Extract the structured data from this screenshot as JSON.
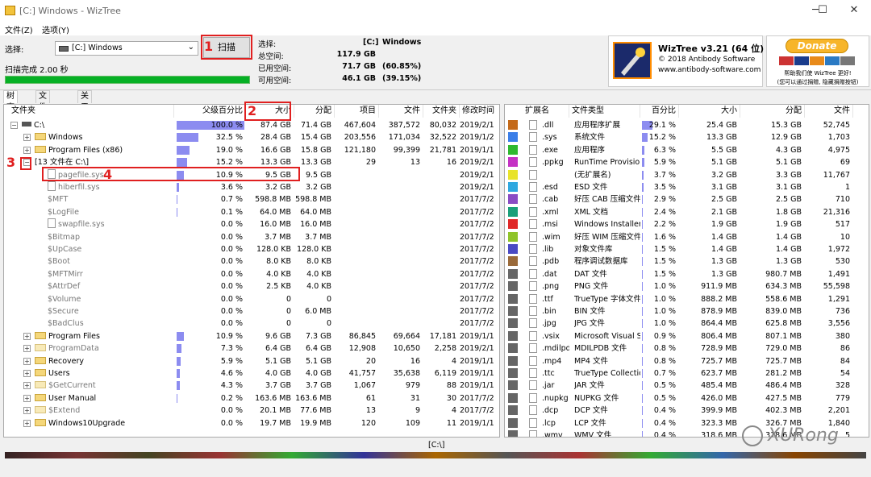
{
  "window": {
    "title": "[C:] Windows  -  WizTree",
    "min": "─",
    "max": "☐",
    "close": "✕"
  },
  "menu": [
    "文件(Z)",
    "选项(Y)"
  ],
  "toolbar": {
    "select_label": "选择:",
    "drive_value": "[C:] Windows",
    "scan_label": "扫描",
    "scan_done": "扫描完成 2.00 秒"
  },
  "info": {
    "select_label": "选择:",
    "select_drive": "[C:]",
    "select_name": "Windows",
    "total_label": "总空间:",
    "total_value": "117.9 GB",
    "used_label": "已用空间:",
    "used_value": "71.7 GB",
    "used_pct": "(60.85%)",
    "free_label": "可用空间:",
    "free_value": "46.1 GB",
    "free_pct": "(39.15%)",
    "progress": 1.0
  },
  "brand": {
    "name": "WizTree v3.21 (64 位)",
    "copyright": "© 2018 Antibody Software",
    "url": "www.antibody-software.com"
  },
  "donate": {
    "button": "Donate",
    "line1": "帮助我们使 WizTree 更好!",
    "line2": "(您可以通过捐赠, 隐藏捐赠按钮)"
  },
  "tabs": [
    "树查看",
    "文件查看",
    "关于"
  ],
  "tree": {
    "headers": [
      "文件夹",
      "父级百分比",
      "大小",
      "分配",
      "项目",
      "文件",
      "文件夹",
      "修改时间"
    ],
    "rows": [
      {
        "name": "C:\\",
        "pct": "100.0 %",
        "pctv": 100,
        "size": "87.4 GB",
        "alloc": "71.4 GB",
        "items": "467,604",
        "files": "387,572",
        "folders": "80,032",
        "mod": "2019/2/1",
        "indent": 0,
        "type": "drive",
        "exp": "-"
      },
      {
        "name": "Windows",
        "pct": "32.5 %",
        "pctv": 32.5,
        "size": "28.4 GB",
        "alloc": "15.4 GB",
        "items": "203,556",
        "files": "171,034",
        "folders": "32,522",
        "mod": "2019/1/2",
        "indent": 1,
        "type": "folder",
        "exp": "+"
      },
      {
        "name": "Program Files (x86)",
        "pct": "19.0 %",
        "pctv": 19,
        "size": "16.6 GB",
        "alloc": "15.8 GB",
        "items": "121,180",
        "files": "99,399",
        "folders": "21,781",
        "mod": "2019/1/1",
        "indent": 1,
        "type": "folder",
        "exp": "+"
      },
      {
        "name": "[13 文件在 C:\\]",
        "pct": "15.2 %",
        "pctv": 15.2,
        "size": "13.3 GB",
        "alloc": "13.3 GB",
        "items": "29",
        "files": "13",
        "folders": "16",
        "mod": "2019/2/1",
        "indent": 1,
        "type": "none",
        "exp": "-"
      },
      {
        "name": "pagefile.sys",
        "pct": "10.9 %",
        "pctv": 10.9,
        "size": "9.5 GB",
        "alloc": "9.5 GB",
        "items": "",
        "files": "",
        "folders": "",
        "mod": "2019/2/1",
        "indent": 2,
        "type": "file",
        "exp": ""
      },
      {
        "name": "hiberfil.sys",
        "pct": "3.6 %",
        "pctv": 3.6,
        "size": "3.2 GB",
        "alloc": "3.2 GB",
        "items": "",
        "files": "",
        "folders": "",
        "mod": "2019/2/1",
        "indent": 2,
        "type": "file",
        "exp": ""
      },
      {
        "name": "$MFT",
        "pct": "0.7 %",
        "pctv": 0.7,
        "size": "598.8 MB",
        "alloc": "598.8 MB",
        "items": "",
        "files": "",
        "folders": "",
        "mod": "2017/7/2",
        "indent": 2,
        "type": "none",
        "exp": ""
      },
      {
        "name": "$LogFile",
        "pct": "0.1 %",
        "pctv": 0.1,
        "size": "64.0 MB",
        "alloc": "64.0 MB",
        "items": "",
        "files": "",
        "folders": "",
        "mod": "2017/7/2",
        "indent": 2,
        "type": "none",
        "exp": ""
      },
      {
        "name": "swapfile.sys",
        "pct": "0.0 %",
        "pctv": 0,
        "size": "16.0 MB",
        "alloc": "16.0 MB",
        "items": "",
        "files": "",
        "folders": "",
        "mod": "2017/7/2",
        "indent": 2,
        "type": "file",
        "exp": ""
      },
      {
        "name": "$Bitmap",
        "pct": "0.0 %",
        "pctv": 0,
        "size": "3.7 MB",
        "alloc": "3.7 MB",
        "items": "",
        "files": "",
        "folders": "",
        "mod": "2017/7/2",
        "indent": 2,
        "type": "none",
        "exp": ""
      },
      {
        "name": "$UpCase",
        "pct": "0.0 %",
        "pctv": 0,
        "size": "128.0 KB",
        "alloc": "128.0 KB",
        "items": "",
        "files": "",
        "folders": "",
        "mod": "2017/7/2",
        "indent": 2,
        "type": "none",
        "exp": ""
      },
      {
        "name": "$Boot",
        "pct": "0.0 %",
        "pctv": 0,
        "size": "8.0 KB",
        "alloc": "8.0 KB",
        "items": "",
        "files": "",
        "folders": "",
        "mod": "2017/7/2",
        "indent": 2,
        "type": "none",
        "exp": ""
      },
      {
        "name": "$MFTMirr",
        "pct": "0.0 %",
        "pctv": 0,
        "size": "4.0 KB",
        "alloc": "4.0 KB",
        "items": "",
        "files": "",
        "folders": "",
        "mod": "2017/7/2",
        "indent": 2,
        "type": "none",
        "exp": ""
      },
      {
        "name": "$AttrDef",
        "pct": "0.0 %",
        "pctv": 0,
        "size": "2.5 KB",
        "alloc": "4.0 KB",
        "items": "",
        "files": "",
        "folders": "",
        "mod": "2017/7/2",
        "indent": 2,
        "type": "none",
        "exp": ""
      },
      {
        "name": "$Volume",
        "pct": "0.0 %",
        "pctv": 0,
        "size": "0",
        "alloc": "0",
        "items": "",
        "files": "",
        "folders": "",
        "mod": "2017/7/2",
        "indent": 2,
        "type": "none",
        "exp": ""
      },
      {
        "name": "$Secure",
        "pct": "0.0 %",
        "pctv": 0,
        "size": "0",
        "alloc": "6.0 MB",
        "items": "",
        "files": "",
        "folders": "",
        "mod": "2017/7/2",
        "indent": 2,
        "type": "none",
        "exp": ""
      },
      {
        "name": "$BadClus",
        "pct": "0.0 %",
        "pctv": 0,
        "size": "0",
        "alloc": "0",
        "items": "",
        "files": "",
        "folders": "",
        "mod": "2017/7/2",
        "indent": 2,
        "type": "none",
        "exp": ""
      },
      {
        "name": "Program Files",
        "pct": "10.9 %",
        "pctv": 10.9,
        "size": "9.6 GB",
        "alloc": "7.3 GB",
        "items": "86,845",
        "files": "69,664",
        "folders": "17,181",
        "mod": "2019/1/1",
        "indent": 1,
        "type": "folder",
        "exp": "+"
      },
      {
        "name": "ProgramData",
        "pct": "7.3 %",
        "pctv": 7.3,
        "size": "6.4 GB",
        "alloc": "6.4 GB",
        "items": "12,908",
        "files": "10,650",
        "folders": "2,258",
        "mod": "2019/2/1",
        "indent": 1,
        "type": "folderg",
        "exp": "+"
      },
      {
        "name": "Recovery",
        "pct": "5.9 %",
        "pctv": 5.9,
        "size": "5.1 GB",
        "alloc": "5.1 GB",
        "items": "20",
        "files": "16",
        "folders": "4",
        "mod": "2019/1/1",
        "indent": 1,
        "type": "folder",
        "exp": "+"
      },
      {
        "name": "Users",
        "pct": "4.6 %",
        "pctv": 4.6,
        "size": "4.0 GB",
        "alloc": "4.0 GB",
        "items": "41,757",
        "files": "35,638",
        "folders": "6,119",
        "mod": "2019/1/1",
        "indent": 1,
        "type": "folder",
        "exp": "+"
      },
      {
        "name": "$GetCurrent",
        "pct": "4.3 %",
        "pctv": 4.3,
        "size": "3.7 GB",
        "alloc": "3.7 GB",
        "items": "1,067",
        "files": "979",
        "folders": "88",
        "mod": "2019/1/1",
        "indent": 1,
        "type": "folderg",
        "exp": "+"
      },
      {
        "name": "User Manual",
        "pct": "0.2 %",
        "pctv": 0.2,
        "size": "163.6 MB",
        "alloc": "163.6 MB",
        "items": "61",
        "files": "31",
        "folders": "30",
        "mod": "2017/7/2",
        "indent": 1,
        "type": "folder",
        "exp": "+"
      },
      {
        "name": "$Extend",
        "pct": "0.0 %",
        "pctv": 0,
        "size": "20.1 MB",
        "alloc": "77.6 MB",
        "items": "13",
        "files": "9",
        "folders": "4",
        "mod": "2017/7/2",
        "indent": 1,
        "type": "folderg",
        "exp": "+"
      },
      {
        "name": "Windows10Upgrade",
        "pct": "0.0 %",
        "pctv": 0,
        "size": "19.7 MB",
        "alloc": "19.9 MB",
        "items": "120",
        "files": "109",
        "folders": "11",
        "mod": "2019/1/1",
        "indent": 1,
        "type": "folder",
        "exp": "+"
      }
    ]
  },
  "ext": {
    "headers": [
      "扩展名",
      "文件类型",
      "百分比",
      "大小",
      "分配",
      "文件"
    ],
    "rows": [
      {
        "color": "#c46a1a",
        "ext": ".dll",
        "type": "应用程序扩展",
        "pct": "29.1 %",
        "pctv": 29.1,
        "size": "25.4 GB",
        "alloc": "15.3 GB",
        "files": "52,745"
      },
      {
        "color": "#3a7ee8",
        "ext": ".sys",
        "type": "系统文件",
        "pct": "15.2 %",
        "pctv": 15.2,
        "size": "13.3 GB",
        "alloc": "12.9 GB",
        "files": "1,703"
      },
      {
        "color": "#2fb82f",
        "ext": ".exe",
        "type": "应用程序",
        "pct": "6.3 %",
        "pctv": 6.3,
        "size": "5.5 GB",
        "alloc": "4.3 GB",
        "files": "4,975"
      },
      {
        "color": "#c431c4",
        "ext": ".ppkg",
        "type": "RunTime Provisioni",
        "pct": "5.9 %",
        "pctv": 5.9,
        "size": "5.1 GB",
        "alloc": "5.1 GB",
        "files": "69"
      },
      {
        "color": "#e8e32a",
        "ext": "",
        "type": "(无扩展名)",
        "pct": "3.7 %",
        "pctv": 3.7,
        "size": "3.2 GB",
        "alloc": "3.3 GB",
        "files": "11,767"
      },
      {
        "color": "#2fa8e0",
        "ext": ".esd",
        "type": "ESD 文件",
        "pct": "3.5 %",
        "pctv": 3.5,
        "size": "3.1 GB",
        "alloc": "3.1 GB",
        "files": "1"
      },
      {
        "color": "#8a4cc4",
        "ext": ".cab",
        "type": "好压 CAB 压缩文件",
        "pct": "2.9 %",
        "pctv": 2.9,
        "size": "2.5 GB",
        "alloc": "2.5 GB",
        "files": "710"
      },
      {
        "color": "#1aa07a",
        "ext": ".xml",
        "type": "XML 文档",
        "pct": "2.4 %",
        "pctv": 2.4,
        "size": "2.1 GB",
        "alloc": "1.8 GB",
        "files": "21,316"
      },
      {
        "color": "#e02828",
        "ext": ".msi",
        "type": "Windows Installer",
        "pct": "2.2 %",
        "pctv": 2.2,
        "size": "1.9 GB",
        "alloc": "1.9 GB",
        "files": "517"
      },
      {
        "color": "#8fc42a",
        "ext": ".wim",
        "type": "好压 WIM 压缩文件",
        "pct": "1.6 %",
        "pctv": 1.6,
        "size": "1.4 GB",
        "alloc": "1.4 GB",
        "files": "10"
      },
      {
        "color": "#4a4ac4",
        "ext": ".lib",
        "type": "对象文件库",
        "pct": "1.5 %",
        "pctv": 1.5,
        "size": "1.4 GB",
        "alloc": "1.4 GB",
        "files": "1,972"
      },
      {
        "color": "#9a6a3a",
        "ext": ".pdb",
        "type": "程序调试数据库",
        "pct": "1.5 %",
        "pctv": 1.5,
        "size": "1.3 GB",
        "alloc": "1.3 GB",
        "files": "530"
      },
      {
        "color": "#666666",
        "ext": ".dat",
        "type": "DAT 文件",
        "pct": "1.5 %",
        "pctv": 1.5,
        "size": "1.3 GB",
        "alloc": "980.7 MB",
        "files": "1,491"
      },
      {
        "color": "#666666",
        "ext": ".png",
        "type": "PNG 文件",
        "pct": "1.0 %",
        "pctv": 1.0,
        "size": "911.9 MB",
        "alloc": "634.3 MB",
        "files": "55,598"
      },
      {
        "color": "#666666",
        "ext": ".ttf",
        "type": "TrueType 字体文件",
        "pct": "1.0 %",
        "pctv": 1.0,
        "size": "888.2 MB",
        "alloc": "558.6 MB",
        "files": "1,291"
      },
      {
        "color": "#666666",
        "ext": ".bin",
        "type": "BIN 文件",
        "pct": "1.0 %",
        "pctv": 1.0,
        "size": "878.9 MB",
        "alloc": "839.0 MB",
        "files": "736"
      },
      {
        "color": "#666666",
        "ext": ".jpg",
        "type": "JPG 文件",
        "pct": "1.0 %",
        "pctv": 1.0,
        "size": "864.4 MB",
        "alloc": "625.8 MB",
        "files": "3,556"
      },
      {
        "color": "#666666",
        "ext": ".vsix",
        "type": "Microsoft Visual St",
        "pct": "0.9 %",
        "pctv": 0.9,
        "size": "806.4 MB",
        "alloc": "807.1 MB",
        "files": "380"
      },
      {
        "color": "#666666",
        "ext": ".mdilpdb",
        "type": "MDILPDB 文件",
        "pct": "0.8 %",
        "pctv": 0.8,
        "size": "728.9 MB",
        "alloc": "729.0 MB",
        "files": "86"
      },
      {
        "color": "#666666",
        "ext": ".mp4",
        "type": "MP4 文件",
        "pct": "0.8 %",
        "pctv": 0.8,
        "size": "725.7 MB",
        "alloc": "725.7 MB",
        "files": "84"
      },
      {
        "color": "#666666",
        "ext": ".ttc",
        "type": "TrueType Collectio",
        "pct": "0.7 %",
        "pctv": 0.7,
        "size": "623.7 MB",
        "alloc": "281.2 MB",
        "files": "54"
      },
      {
        "color": "#666666",
        "ext": ".jar",
        "type": "JAR 文件",
        "pct": "0.5 %",
        "pctv": 0.5,
        "size": "485.4 MB",
        "alloc": "486.4 MB",
        "files": "328"
      },
      {
        "color": "#666666",
        "ext": ".nupkg",
        "type": "NUPKG 文件",
        "pct": "0.5 %",
        "pctv": 0.5,
        "size": "426.0 MB",
        "alloc": "427.5 MB",
        "files": "779"
      },
      {
        "color": "#666666",
        "ext": ".dcp",
        "type": "DCP 文件",
        "pct": "0.4 %",
        "pctv": 0.4,
        "size": "399.9 MB",
        "alloc": "402.3 MB",
        "files": "2,201"
      },
      {
        "color": "#666666",
        "ext": ".lcp",
        "type": "LCP 文件",
        "pct": "0.4 %",
        "pctv": 0.4,
        "size": "323.3 MB",
        "alloc": "326.7 MB",
        "files": "1,840"
      },
      {
        "color": "#666666",
        "ext": ".wmv",
        "type": "WMV 文件",
        "pct": "0.4 %",
        "pctv": 0.4,
        "size": "318.6 MB",
        "alloc": "318.6 MB",
        "files": "5"
      }
    ]
  },
  "status": {
    "path": "[C:\\]"
  },
  "watermark": "XURong",
  "annotations": [
    "1",
    "2",
    "3",
    "4"
  ],
  "sort_arrow": "▼"
}
